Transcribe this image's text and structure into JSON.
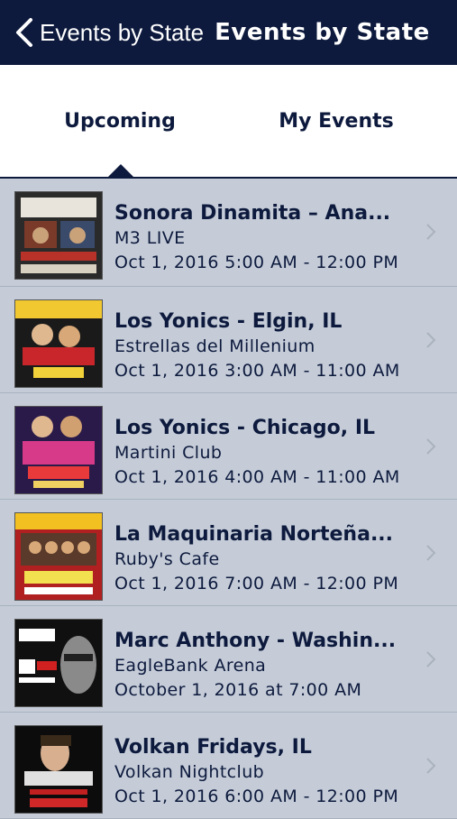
{
  "nav": {
    "back_label": "Events by State",
    "title": "Events by State"
  },
  "tabs": [
    {
      "label": "Upcoming",
      "selected": true
    },
    {
      "label": "My Events",
      "selected": false
    }
  ],
  "events": [
    {
      "title": "Sonora Dinamita – Ana...",
      "venue": "M3 LIVE",
      "date": "Oct 1, 2016 5:00 AM - 12:00 PM"
    },
    {
      "title": "Los Yonics - Elgin, IL",
      "venue": "Estrellas del Millenium",
      "date": "Oct 1, 2016 3:00 AM - 11:00 AM"
    },
    {
      "title": "Los Yonics - Chicago, IL",
      "venue": "Martini Club",
      "date": "Oct 1, 2016 4:00 AM - 11:00 AM"
    },
    {
      "title": "La Maquinaria Norteña...",
      "venue": "Ruby's Cafe",
      "date": "Oct 1, 2016 7:00 AM - 12:00 PM"
    },
    {
      "title": "Marc Anthony - Washin...",
      "venue": "EagleBank Arena",
      "date": "October 1, 2016 at 7:00 AM"
    },
    {
      "title": "Volkan Fridays, IL",
      "venue": "Volkan Nightclub",
      "date": "Oct 1, 2016 6:00 AM - 12:00 PM"
    }
  ],
  "colors": {
    "navbar": "#0d1a3d",
    "row_background": "#c5ccd8",
    "text": "#0d1a3d"
  }
}
